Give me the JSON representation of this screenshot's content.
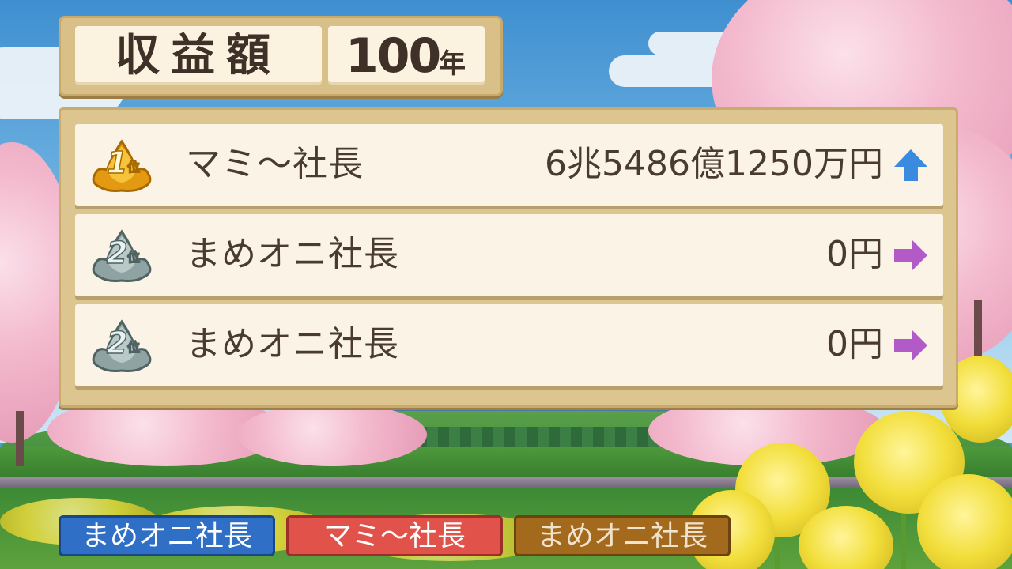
{
  "header": {
    "title": "収益額",
    "year_number": "100",
    "year_unit": "年"
  },
  "ranking": {
    "rows": [
      {
        "rank_number": "1",
        "rank_unit": "位",
        "badge_color": "gold",
        "name": "マミ〜社長",
        "amount": "6兆5486億1250万円",
        "trend": "up-arrow",
        "trend_color": "#3a8be0"
      },
      {
        "rank_number": "2",
        "rank_unit": "位",
        "badge_color": "silver",
        "name": "まめオニ社長",
        "amount": "0円",
        "trend": "right-arrow",
        "trend_color": "#b35ac9"
      },
      {
        "rank_number": "2",
        "rank_unit": "位",
        "badge_color": "silver",
        "name": "まめオニ社長",
        "amount": "0円",
        "trend": "right-arrow",
        "trend_color": "#b35ac9"
      }
    ]
  },
  "players": [
    {
      "label": "まめオニ社長",
      "color": "#2f6fc6"
    },
    {
      "label": "マミ〜社長",
      "color": "#e0524a"
    },
    {
      "label": "まめオニ社長",
      "color": "#a3691d"
    }
  ]
}
